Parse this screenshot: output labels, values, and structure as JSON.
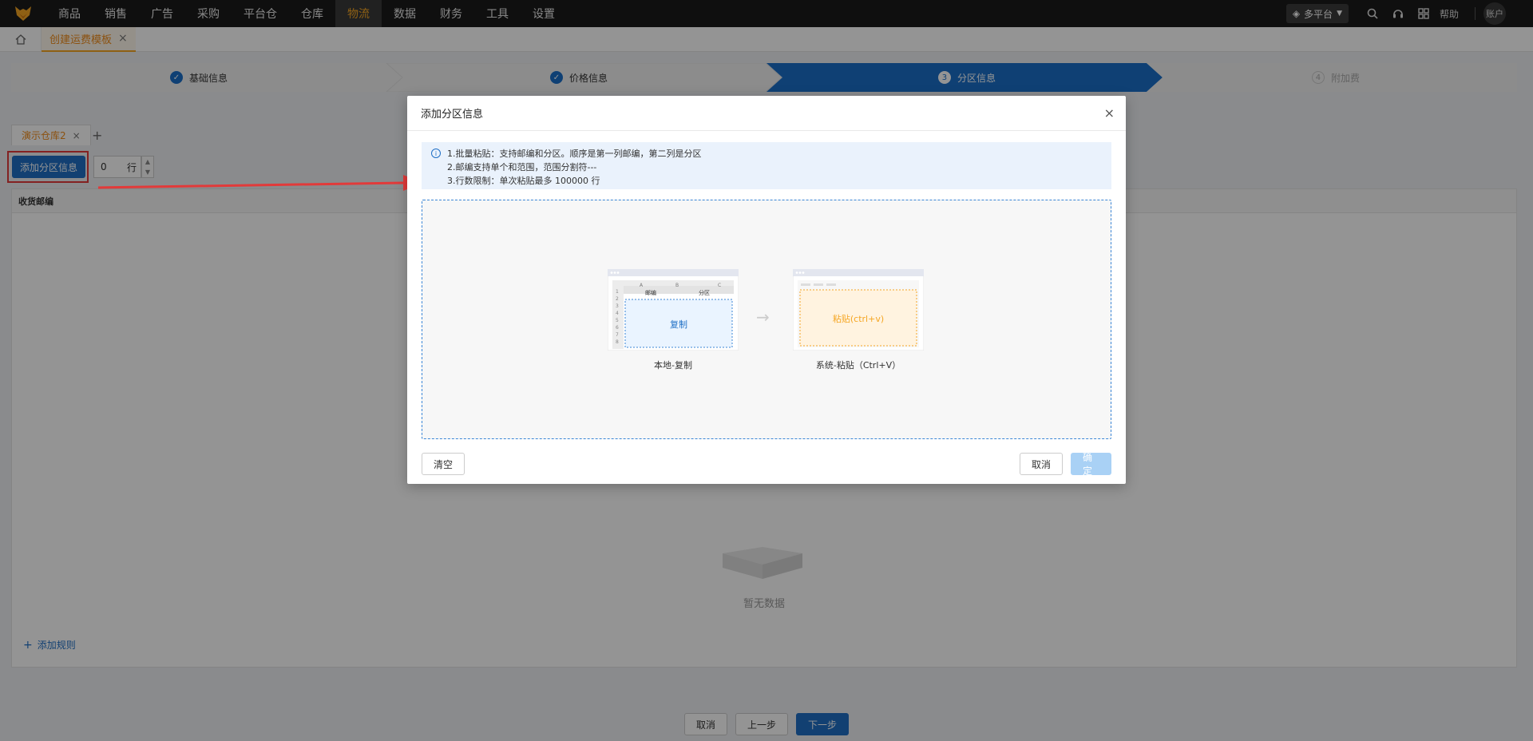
{
  "topnav": {
    "items": [
      "商品",
      "销售",
      "广告",
      "采购",
      "平台仓",
      "仓库",
      "物流",
      "数据",
      "财务",
      "工具",
      "设置"
    ],
    "active_index": 6,
    "platform_label": "多平台",
    "help_label": "帮助",
    "account_label": "账户",
    "icons": [
      "search-icon",
      "headset-icon",
      "apps-icon"
    ]
  },
  "tabbar": {
    "page_tab_label": "创建运费模板"
  },
  "steps": [
    {
      "label": "基础信息",
      "state": "done"
    },
    {
      "label": "价格信息",
      "state": "done"
    },
    {
      "label": "分区信息",
      "state": "current",
      "num": "3"
    },
    {
      "label": "附加费",
      "state": "future",
      "num": "4"
    }
  ],
  "content": {
    "warehouse_tab": "演示仓库2",
    "add_zone_btn": "添加分区信息",
    "row_count": "0",
    "row_unit": "行",
    "column_header": "收货邮编",
    "empty_text": "暂无数据",
    "add_rule": "添加规则"
  },
  "bottom": {
    "cancel": "取消",
    "prev": "上一步",
    "next": "下一步"
  },
  "modal": {
    "title": "添加分区信息",
    "tips": [
      "1.批量粘贴：支持邮编和分区。顺序是第一列邮编，第二列是分区",
      "2.邮编支持单个和范围，范围分割符---",
      "3.行数限制：单次粘贴最多 100000 行"
    ],
    "illu_left": {
      "col_a": "A",
      "col_b": "B",
      "col_c": "C",
      "header_zip": "邮编",
      "header_zone": "分区",
      "rows": [
        "1",
        "2",
        "3",
        "4",
        "5",
        "6",
        "7",
        "8"
      ],
      "center_text": "复制",
      "caption": "本地-复制"
    },
    "illu_right": {
      "center_text": "粘贴(ctrl+v)",
      "caption": "系统-粘贴（Ctrl+V）"
    },
    "clear_btn": "清空",
    "cancel_btn": "取消",
    "ok_btn": "确定"
  },
  "colors": {
    "primary": "#1f6fc5",
    "accent": "#f5a623",
    "annotation": "#e23a3a"
  }
}
